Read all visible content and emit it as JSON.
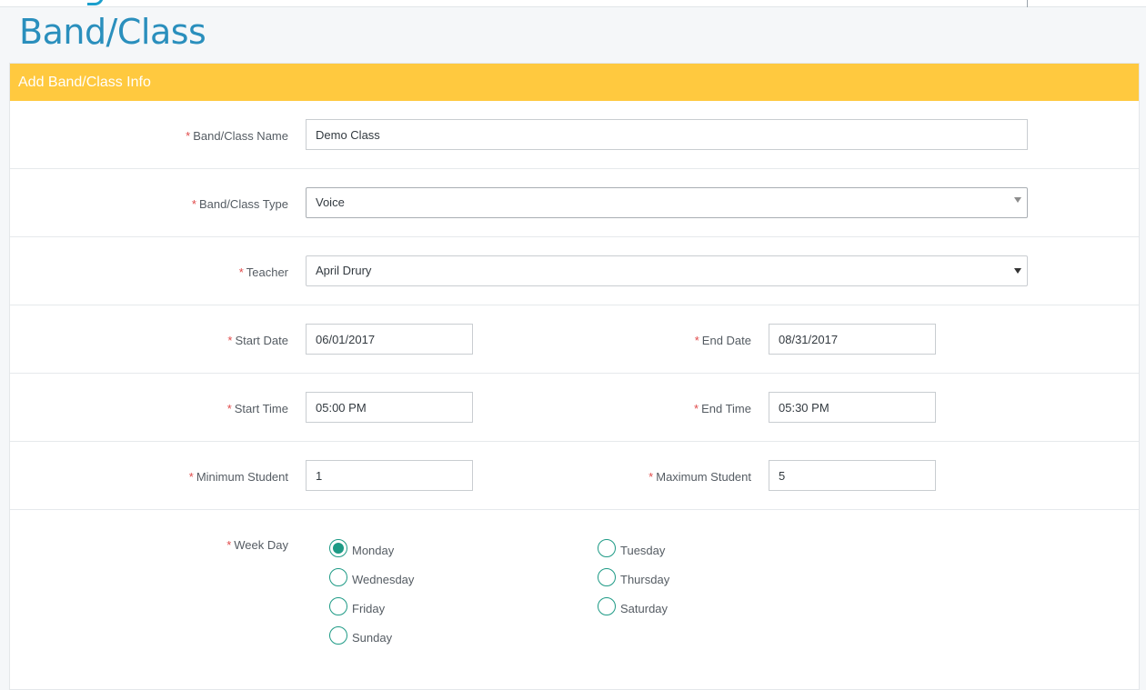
{
  "page": {
    "title": "Band/Class"
  },
  "panel": {
    "header": "Add Band/Class Info"
  },
  "form": {
    "name": {
      "label": "Band/Class Name",
      "value": "Demo Class"
    },
    "type": {
      "label": "Band/Class Type",
      "value": "Voice"
    },
    "teacher": {
      "label": "Teacher",
      "value": "April Drury"
    },
    "start_date": {
      "label": "Start Date",
      "value": "06/01/2017"
    },
    "end_date": {
      "label": "End Date",
      "value": "08/31/2017"
    },
    "start_time": {
      "label": "Start Time",
      "value": "05:00 PM"
    },
    "end_time": {
      "label": "End Time",
      "value": "05:30 PM"
    },
    "min_student": {
      "label": "Minimum Student",
      "value": "1"
    },
    "max_student": {
      "label": "Maximum Student",
      "value": "5"
    },
    "week_day": {
      "label": "Week Day",
      "selected": "Monday",
      "options": [
        "Monday",
        "Tuesday",
        "Wednesday",
        "Thursday",
        "Friday",
        "Saturday",
        "Sunday"
      ]
    },
    "required_marker": "*"
  },
  "colors": {
    "title": "#2a8fbd",
    "header_bg": "#ffc93f",
    "radio_accent": "#1d9a85",
    "required": "#e04a4a"
  }
}
